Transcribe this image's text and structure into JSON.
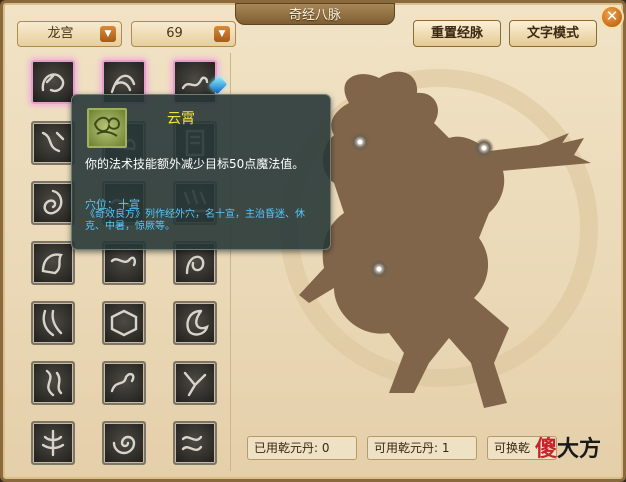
{
  "window": {
    "title": "奇经八脉",
    "close_glyph": "✕"
  },
  "controls": {
    "school_select": {
      "value": "龙宫"
    },
    "level_select": {
      "value": "69"
    },
    "reset_button": "重置经脉",
    "text_mode_button": "文字模式"
  },
  "tooltip": {
    "name": "云霄",
    "description": "你的法术技能额外减少目标50点魔法值。",
    "acupoint": "穴位：十宣",
    "detail": "《奇效良方》列作经外穴，名十宣，主治昏迷、休克、中暑，惊厥等。"
  },
  "stats": {
    "used": "已用乾元丹: 0",
    "available": "可用乾元丹: 1",
    "exchangeable": "可换乾"
  },
  "watermark": {
    "part1": "傻",
    "part2": "大方"
  },
  "skill_icons": [
    "dragon-icon",
    "serpent-icon",
    "wave-icon",
    "storm-icon",
    "cloud-icon",
    "talisman-icon",
    "whirlpool-icon",
    "scroll-icon",
    "rain-icon",
    "beast-icon",
    "mist-icon",
    "coil-icon",
    "claw-icon",
    "tablet-icon",
    "moon-icon",
    "flame-icon",
    "dragon-coil-icon",
    "crack-icon",
    "tree-icon",
    "spiral-icon",
    "tide-icon"
  ]
}
